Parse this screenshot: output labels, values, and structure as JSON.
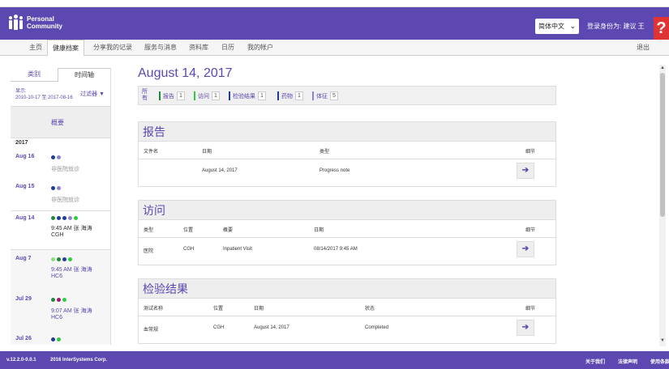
{
  "header": {
    "logo_line1": "Personal",
    "logo_line2": "Community",
    "language": "简体中文",
    "login_text": "登录身份为: 建议 王",
    "help_label": "?"
  },
  "nav": {
    "items": [
      "主页",
      "健康档案",
      "分享我的记录",
      "服务与消息",
      "资料库",
      "日历",
      "我的帐户"
    ],
    "logout": "退出"
  },
  "sidebar": {
    "tab_category": "类别",
    "tab_timeline": "时间轴",
    "show_label": "显示:",
    "show_range": "2010-10-17 至 2017-08-16",
    "filter_label": "过滤器",
    "summary_link": "概要",
    "year": "2017",
    "entries": [
      {
        "date": "Aug 16",
        "sub": "非医院就诊",
        "time": "",
        "loc": ""
      },
      {
        "date": "Aug 15",
        "sub": "非医院就诊",
        "time": "",
        "loc": ""
      },
      {
        "date": "Aug 14",
        "sub": "",
        "time": "9:45 AM 张 海涛",
        "loc": "CGH"
      },
      {
        "date": "Aug 7",
        "sub": "",
        "time": "9:45 AM 张 海涛",
        "loc": "HC6"
      },
      {
        "date": "Jul 29",
        "sub": "",
        "time": "9:07 AM 张 海涛",
        "loc": "HC6"
      },
      {
        "date": "Jul 26",
        "sub": "",
        "time": "",
        "loc": ""
      }
    ]
  },
  "main": {
    "date_title": "August 14, 2017",
    "chip_all": "所有",
    "chips": [
      {
        "label": "报告",
        "count": "1"
      },
      {
        "label": "访问",
        "count": "1"
      },
      {
        "label": "检验结果",
        "count": "1"
      },
      {
        "label": "药物",
        "count": "1"
      },
      {
        "label": "体征",
        "count": "5"
      }
    ],
    "reports": {
      "title": "报告",
      "cols": [
        "文件名",
        "日期",
        "类型",
        "细节"
      ],
      "row": {
        "filename": "",
        "date": "August 14, 2017",
        "type": "Progress note"
      }
    },
    "visits": {
      "title": "访问",
      "cols": [
        "类型",
        "位置",
        "概要",
        "日期",
        "细节"
      ],
      "row": {
        "type": "医院",
        "location": "CGH",
        "summary": "Inpatient Visit",
        "date": "08/14/2017 9:45 AM"
      }
    },
    "labs": {
      "title": "检验结果",
      "cols": [
        "测试名称",
        "位置",
        "日期",
        "状态",
        "细节"
      ],
      "row": {
        "test": "血常规",
        "location": "CGH",
        "date": "August 14, 2017",
        "status": "Completed"
      }
    }
  },
  "footer": {
    "version": "v.12.2.0-0.0.1",
    "copyright": "2016 InterSystems Corp.",
    "about": "关于我们",
    "legal": "法律声明",
    "terms": "使用条款"
  },
  "colors": {
    "brand": "#5d47b1",
    "help": "#e03434"
  }
}
